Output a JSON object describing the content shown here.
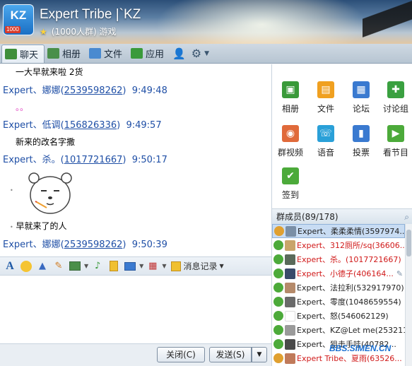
{
  "header": {
    "logo_text": "KZ",
    "logo_badge": "1000",
    "title": "Expert Tribe |`KZ",
    "subtitle": "(1000人群) 游戏"
  },
  "tabs": [
    {
      "label": "聊天",
      "icon": "chat-icon",
      "color": "#3f8f3a"
    },
    {
      "label": "相册",
      "icon": "album-icon",
      "color": "#4a8f4a"
    },
    {
      "label": "文件",
      "icon": "folder-icon",
      "color": "#4a8ad0"
    },
    {
      "label": "应用",
      "icon": "apps-icon",
      "color": "#3a9a3a"
    }
  ],
  "chat": {
    "messages": [
      {
        "type": "text",
        "text": "一大早就来啦  2货"
      },
      {
        "type": "sender",
        "name": "Expert、娜娜(",
        "qq": "2539598262",
        "close": ")",
        "time": "9:49:48"
      },
      {
        "type": "text",
        "text": "。。",
        "color": "#e040c0"
      },
      {
        "type": "sender",
        "name": "Expert、低调(",
        "qq": "156826336",
        "close": ")",
        "time": "9:49:57"
      },
      {
        "type": "text",
        "text": "新来的改名字撒"
      },
      {
        "type": "sender",
        "name": "Expert、杀。(",
        "qq": "1017721667",
        "close": ")",
        "time": "9:50:17"
      },
      {
        "type": "text",
        "text": "早就来了的人"
      },
      {
        "type": "sender",
        "name": "Expert、娜娜(",
        "qq": "2539598262",
        "close": ")",
        "time": "9:50:39"
      }
    ]
  },
  "compose": {
    "history_label": "消息记录"
  },
  "buttons": {
    "close": "关闭(C)",
    "send": "发送(S)"
  },
  "apps": [
    {
      "label": "相册",
      "color": "#3a9a3a",
      "glyph": "▣"
    },
    {
      "label": "文件",
      "color": "#f0a020",
      "glyph": "▤"
    },
    {
      "label": "论坛",
      "color": "#3a7ad0",
      "glyph": "▦"
    },
    {
      "label": "讨论组",
      "color": "#3aa040",
      "glyph": "✚"
    },
    {
      "label": "群视频",
      "color": "#e06a3a",
      "glyph": "◉"
    },
    {
      "label": "语音",
      "color": "#2aa0d8",
      "glyph": "☏"
    },
    {
      "label": "投票",
      "color": "#3a7ad0",
      "glyph": "▮"
    },
    {
      "label": "看节目",
      "color": "#4caa3a",
      "glyph": "▶"
    },
    {
      "label": "签到",
      "color": "#4caa3a",
      "glyph": "✔"
    }
  ],
  "members": {
    "header": "群成员(89/178)",
    "list": [
      {
        "name": "Expert、柔柔柔情(3597974...",
        "color": "#222",
        "selected": true
      },
      {
        "name": "Expert、312厕所/sq(36606...",
        "color": "#d01818",
        "selected": false
      },
      {
        "name": "Expert、杀。(1017721667)",
        "color": "#d01818",
        "selected": false
      },
      {
        "name": "Expert、小德子(406164...",
        "color": "#d01818",
        "selected": false
      },
      {
        "name": "Expert、法拉利(532917970)",
        "color": "#222",
        "selected": false
      },
      {
        "name": "Expert、零度(1048659554)",
        "color": "#222",
        "selected": false
      },
      {
        "name": "Expert、怒(546062129)",
        "color": "#222",
        "selected": false
      },
      {
        "name": "Expert、KZ@Let me(253211...",
        "color": "#222",
        "selected": false
      },
      {
        "name": "Expert、狙击手哇(40782...",
        "color": "#222",
        "selected": false
      },
      {
        "name": "Expert Tribe、夏雨(63526...",
        "color": "#d01818",
        "selected": false
      }
    ]
  },
  "watermark": "BBS.SIMEN.CN"
}
